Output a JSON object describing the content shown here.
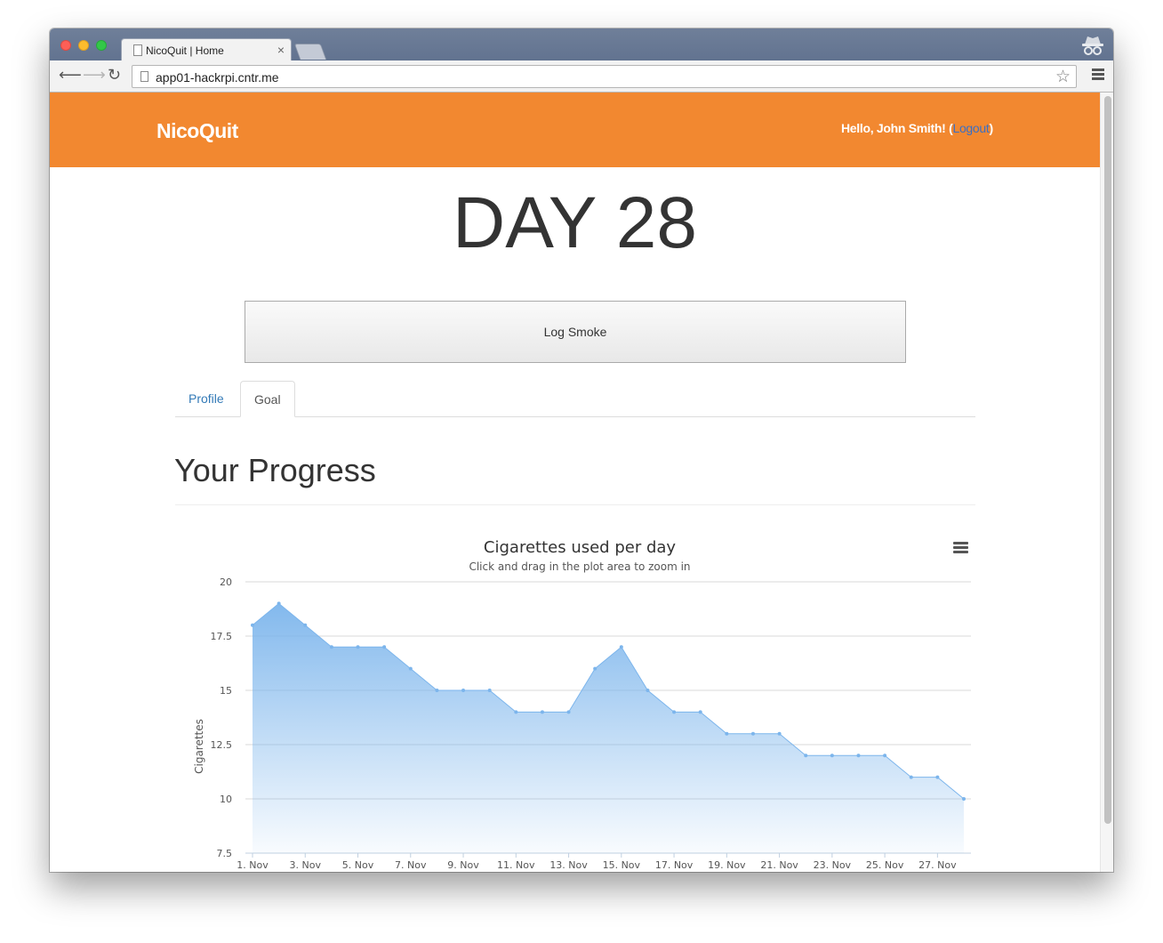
{
  "browser": {
    "tab_title": "NicoQuit | Home",
    "tab_close": "×",
    "url": "app01-hackrpi.cntr.me"
  },
  "header": {
    "brand": "NicoQuit",
    "greeting_prefix": "Hello, John Smith! (",
    "logout_label": "Logout",
    "greeting_suffix": ")"
  },
  "main": {
    "day_heading": "DAY 28",
    "log_button_label": "Log Smoke",
    "tabs": [
      {
        "label": "Profile",
        "active": false
      },
      {
        "label": "Goal",
        "active": true
      }
    ],
    "section_title": "Your Progress"
  },
  "colors": {
    "header_bg": "#f28830",
    "link": "#337ab7",
    "series": "#7cb5ec"
  },
  "chart_data": {
    "type": "area",
    "title": "Cigarettes used per day",
    "subtitle": "Click and drag in the plot area to zoom in",
    "ylabel": "Cigarettes",
    "xlabel": "",
    "ylim": [
      7.5,
      20
    ],
    "yticks": [
      7.5,
      10,
      12.5,
      15,
      17.5,
      20
    ],
    "xtick_labels": [
      "1. Nov",
      "3. Nov",
      "5. Nov",
      "7. Nov",
      "9. Nov",
      "11. Nov",
      "13. Nov",
      "15. Nov",
      "17. Nov",
      "19. Nov",
      "21. Nov",
      "23. Nov",
      "25. Nov",
      "27. Nov"
    ],
    "x_days": [
      1,
      2,
      3,
      4,
      5,
      6,
      7,
      8,
      9,
      10,
      11,
      12,
      13,
      14,
      15,
      16,
      17,
      18,
      19,
      20,
      21,
      22,
      23,
      24,
      25,
      26,
      27,
      28
    ],
    "values": [
      18,
      19,
      18,
      17,
      17,
      17,
      16,
      15,
      15,
      15,
      14,
      14,
      14,
      16,
      17,
      15,
      14,
      14,
      13,
      13,
      13,
      12,
      12,
      12,
      12,
      11,
      11,
      10
    ],
    "grid": true,
    "legend": "none"
  }
}
